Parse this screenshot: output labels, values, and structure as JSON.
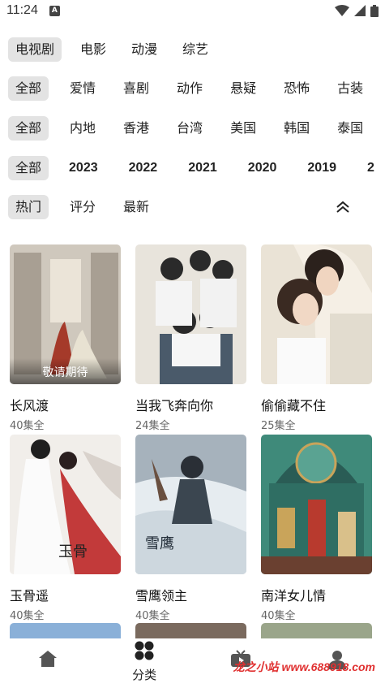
{
  "status": {
    "time": "11:24"
  },
  "filters": {
    "type": {
      "items": [
        "电视剧",
        "电影",
        "动漫",
        "综艺"
      ],
      "active": 0
    },
    "genre": {
      "items": [
        "全部",
        "爱情",
        "喜剧",
        "动作",
        "悬疑",
        "恐怖",
        "古装"
      ],
      "active": 0
    },
    "region": {
      "items": [
        "全部",
        "内地",
        "香港",
        "台湾",
        "美国",
        "韩国",
        "泰国"
      ],
      "active": 0
    },
    "year": {
      "items": [
        "全部",
        "2023",
        "2022",
        "2021",
        "2020",
        "2019",
        "2"
      ],
      "active": 0
    },
    "sort": {
      "items": [
        "热门",
        "评分",
        "最新"
      ],
      "active": 0
    }
  },
  "shows": [
    {
      "title": "长风渡",
      "episodes": "40集全",
      "badge": "敬请期待",
      "colors": [
        "#cfc8bd",
        "#7d6f62",
        "#a53a2a"
      ]
    },
    {
      "title": "当我飞奔向你",
      "episodes": "24集全",
      "badge": "",
      "colors": [
        "#e8e4dc",
        "#4a5a6a",
        "#f2f2f2"
      ]
    },
    {
      "title": "偷偷藏不住",
      "episodes": "25集全",
      "badge": "",
      "colors": [
        "#eae3d6",
        "#b49a7a",
        "#f5efe5"
      ]
    },
    {
      "title": "玉骨遥",
      "episodes": "40集全",
      "badge": "",
      "colors": [
        "#f1eeea",
        "#c23a3a",
        "#e9e3dd"
      ]
    },
    {
      "title": "雪鹰领主",
      "episodes": "40集全",
      "badge": "",
      "colors": [
        "#a6b2bc",
        "#3b4650",
        "#e6ecf0"
      ]
    },
    {
      "title": "南洋女儿情",
      "episodes": "40集全",
      "badge": "",
      "colors": [
        "#3f8a7a",
        "#c9a45a",
        "#2a5c55"
      ]
    }
  ],
  "partial_colors": [
    "#8ab0d8",
    "#7a6a5e",
    "#9aa58a"
  ],
  "nav": {
    "tabs": [
      "首页",
      "分类",
      "直播",
      "我的"
    ],
    "active": 1,
    "active_label": "分类"
  },
  "watermark": "龙之小站 www.688918.com"
}
